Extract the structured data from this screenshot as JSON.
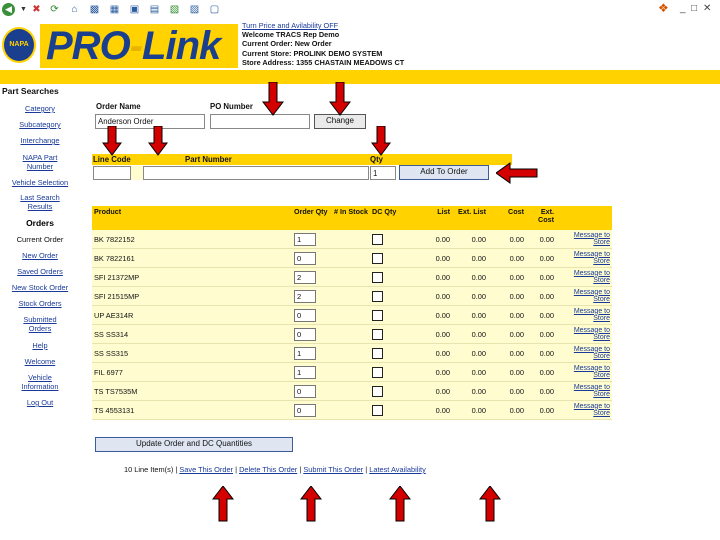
{
  "browser": {
    "back_icon": "back-arrow-icon",
    "forward_icon": "forward-arrow-icon",
    "windows_logo_icon": "windows-flag-icon"
  },
  "header": {
    "logo_napa": "NAPA",
    "logo_text_pro": "PRO",
    "logo_text_link": "Link",
    "info_lines": [
      "Turn Price and Avilability OFF",
      "Welcome TRACS Rep Demo",
      "Current Order: New Order",
      "Current Store: PROLINK DEMO SYSTEM",
      "Store Address: 1355 CHASTAIN MEADOWS CT"
    ]
  },
  "sidebar": {
    "part_searches_title": "Part Searches",
    "part_links": [
      "Category",
      "Subcategory",
      "Interchange",
      "NAPA Part Number",
      "Vehicle Selection",
      "Last Search Results"
    ],
    "orders_title": "Orders",
    "order_items": [
      "Current Order",
      "New Order",
      "Saved Orders",
      "New Stock Order",
      "Stock Orders",
      "Submitted Orders",
      "Help",
      "Welcome",
      "Vehicle Information",
      "Log Out"
    ]
  },
  "order_form": {
    "order_name_label": "Order Name",
    "po_number_label": "PO Number",
    "order_name_value": "Anderson Order",
    "po_number_value": "",
    "change_button": "Change",
    "line_code_label": "Line Code",
    "part_number_label": "Part Number",
    "qty_label": "Qty",
    "line_code_value": "",
    "part_number_value": "",
    "qty_value": "1",
    "add_button": "Add To Order"
  },
  "table": {
    "headers": [
      "Product",
      "Order Qty",
      "# In Stock",
      "DC Qty",
      "List",
      "Ext. List",
      "Cost",
      "Ext. Cost",
      ""
    ],
    "message_link": "Message to Store",
    "rows": [
      {
        "product": "BK 7822152",
        "qty": "1",
        "stock": "",
        "list": "0.00",
        "ext_list": "0.00",
        "cost": "0.00",
        "ext_cost": "0.00"
      },
      {
        "product": "BK 7822161",
        "qty": "0",
        "stock": "",
        "list": "0.00",
        "ext_list": "0.00",
        "cost": "0.00",
        "ext_cost": "0.00"
      },
      {
        "product": "SFI 21372MP",
        "qty": "2",
        "stock": "",
        "list": "0.00",
        "ext_list": "0.00",
        "cost": "0.00",
        "ext_cost": "0.00"
      },
      {
        "product": "SFI 21515MP",
        "qty": "2",
        "stock": "",
        "list": "0.00",
        "ext_list": "0.00",
        "cost": "0.00",
        "ext_cost": "0.00"
      },
      {
        "product": "UP AE314R",
        "qty": "0",
        "stock": "",
        "list": "0.00",
        "ext_list": "0.00",
        "cost": "0.00",
        "ext_cost": "0.00"
      },
      {
        "product": "SS SS314",
        "qty": "0",
        "stock": "",
        "list": "0.00",
        "ext_list": "0.00",
        "cost": "0.00",
        "ext_cost": "0.00"
      },
      {
        "product": "SS SS315",
        "qty": "1",
        "stock": "",
        "list": "0.00",
        "ext_list": "0.00",
        "cost": "0.00",
        "ext_cost": "0.00"
      },
      {
        "product": "FIL 6977",
        "qty": "1",
        "stock": "",
        "list": "0.00",
        "ext_list": "0.00",
        "cost": "0.00",
        "ext_cost": "0.00"
      },
      {
        "product": "TS TS7535M",
        "qty": "0",
        "stock": "",
        "list": "0.00",
        "ext_list": "0.00",
        "cost": "0.00",
        "ext_cost": "0.00"
      },
      {
        "product": "TS 4553131",
        "qty": "0",
        "stock": "",
        "list": "0.00",
        "ext_list": "0.00",
        "cost": "0.00",
        "ext_cost": "0.00"
      }
    ]
  },
  "update_button": "Update Order and DC Quantities",
  "footer": {
    "line_count": "10 Line Item(s)",
    "sep": "|",
    "links": [
      "Save This Order",
      "Delete This Order",
      "Submit This Order",
      "Latest Availability"
    ]
  },
  "colors": {
    "accent_yellow": "#ffd200",
    "row_bg": "#fffdd0",
    "link_blue": "#1a3a9a",
    "arrow_red": "#d40000",
    "logo_blue": "#1a3f8f"
  }
}
